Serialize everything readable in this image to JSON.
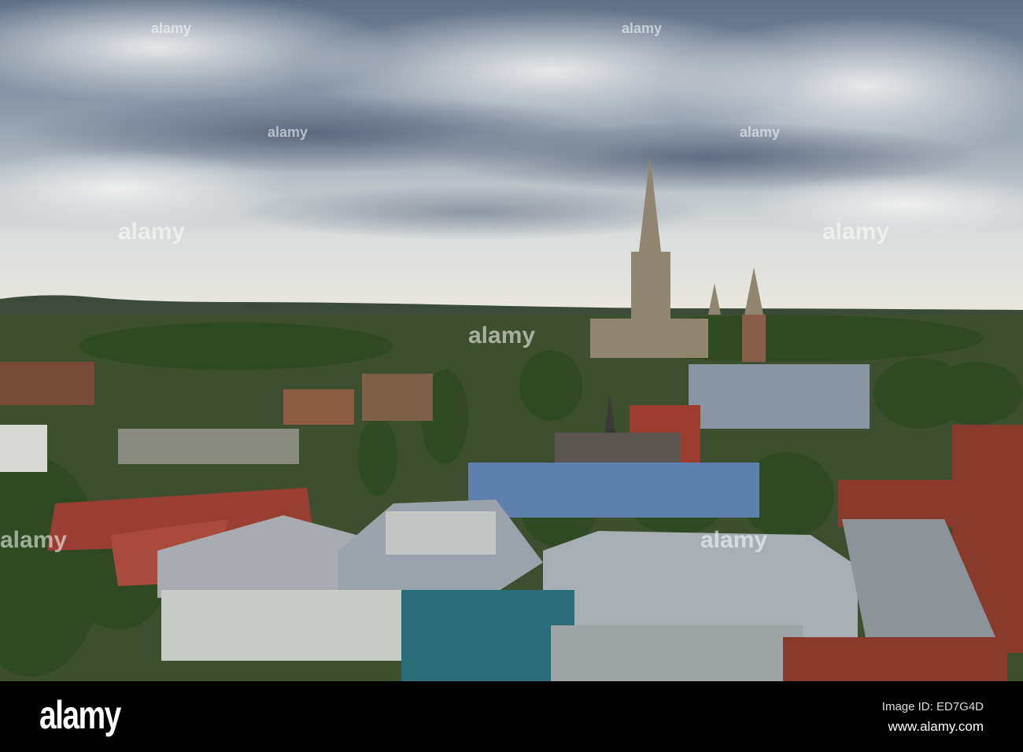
{
  "photo": {
    "subject": "city skyline with cathedral spire"
  },
  "watermark": {
    "text": "alamy"
  },
  "footer": {
    "logo": "alamy",
    "image_id": "Image ID: ED7G4D",
    "website": "www.alamy.com"
  }
}
